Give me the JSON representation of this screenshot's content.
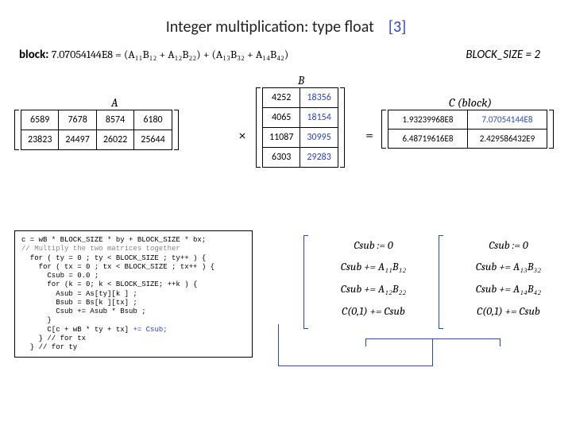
{
  "title": {
    "main": "Integer multiplication: type float",
    "index": "[3]"
  },
  "header": {
    "block_label": "block:",
    "block_expr": "7.07054144E8 = (A₁₁B₁₂ + A₁₂B₂₂) + (A₁₃B₃₂ + A₁₄B₄₂)",
    "block_size": "BLOCK_SIZE = 2"
  },
  "labels": {
    "A": "A",
    "B": "B",
    "C": "C (block)",
    "times": "×",
    "equals": "="
  },
  "A": [
    [
      "6589",
      "7678",
      "8574",
      "6180"
    ],
    [
      "23823",
      "24497",
      "26022",
      "25644"
    ]
  ],
  "B": [
    [
      "4252",
      "18356"
    ],
    [
      "4065",
      "18154"
    ],
    [
      "11087",
      "30995"
    ],
    [
      "6303",
      "29283"
    ]
  ],
  "blueB": {
    "r0c1": true,
    "r1c1": true,
    "r2c1": true,
    "r3c1": true
  },
  "C": [
    [
      "1.93239968E8",
      "7.07054144E8"
    ],
    [
      "6.48719616E8",
      "2.429586432E9"
    ]
  ],
  "blueC": {
    "r0c1": true
  },
  "code": {
    "l1a": "c = wB * BLOCK_SIZE * by + BLOCK_SIZE * bx;",
    "l2": "// Multiply the two matrices together",
    "l3": "  for ( ty = 0 ; ty < BLOCK_SIZE ; ty++ ) {",
    "l4": "    for ( tx = 0 ; tx < BLOCK_SIZE ; tx++ ) {",
    "l5": "      Csub = 0.0 ;",
    "l6": "      for (k = 0; k < BLOCK_SIZE; ++k ) {",
    "l7": "        Asub = As[ty][k ] ;",
    "l8": "        Bsub = Bs[k ][tx] ;",
    "l9": "        Csub += Asub * Bsub ;",
    "l10": "      }",
    "l11a": "      C[c + wB * ty + tx] ",
    "l11b": "+= Csub;",
    "l12": "    } // for tx",
    "l13": "  } // for ty"
  },
  "formulas": {
    "col1": [
      "Csub := 0",
      "Csub += A₁₁B₁₂",
      "Csub += A₁₂B₂₂",
      "C(0,1) += Csub"
    ],
    "col2": [
      "Csub := 0",
      "Csub += A₁₃B₃₂",
      "Csub += A₁₄B₄₂",
      "C(0,1) += Csub"
    ]
  }
}
